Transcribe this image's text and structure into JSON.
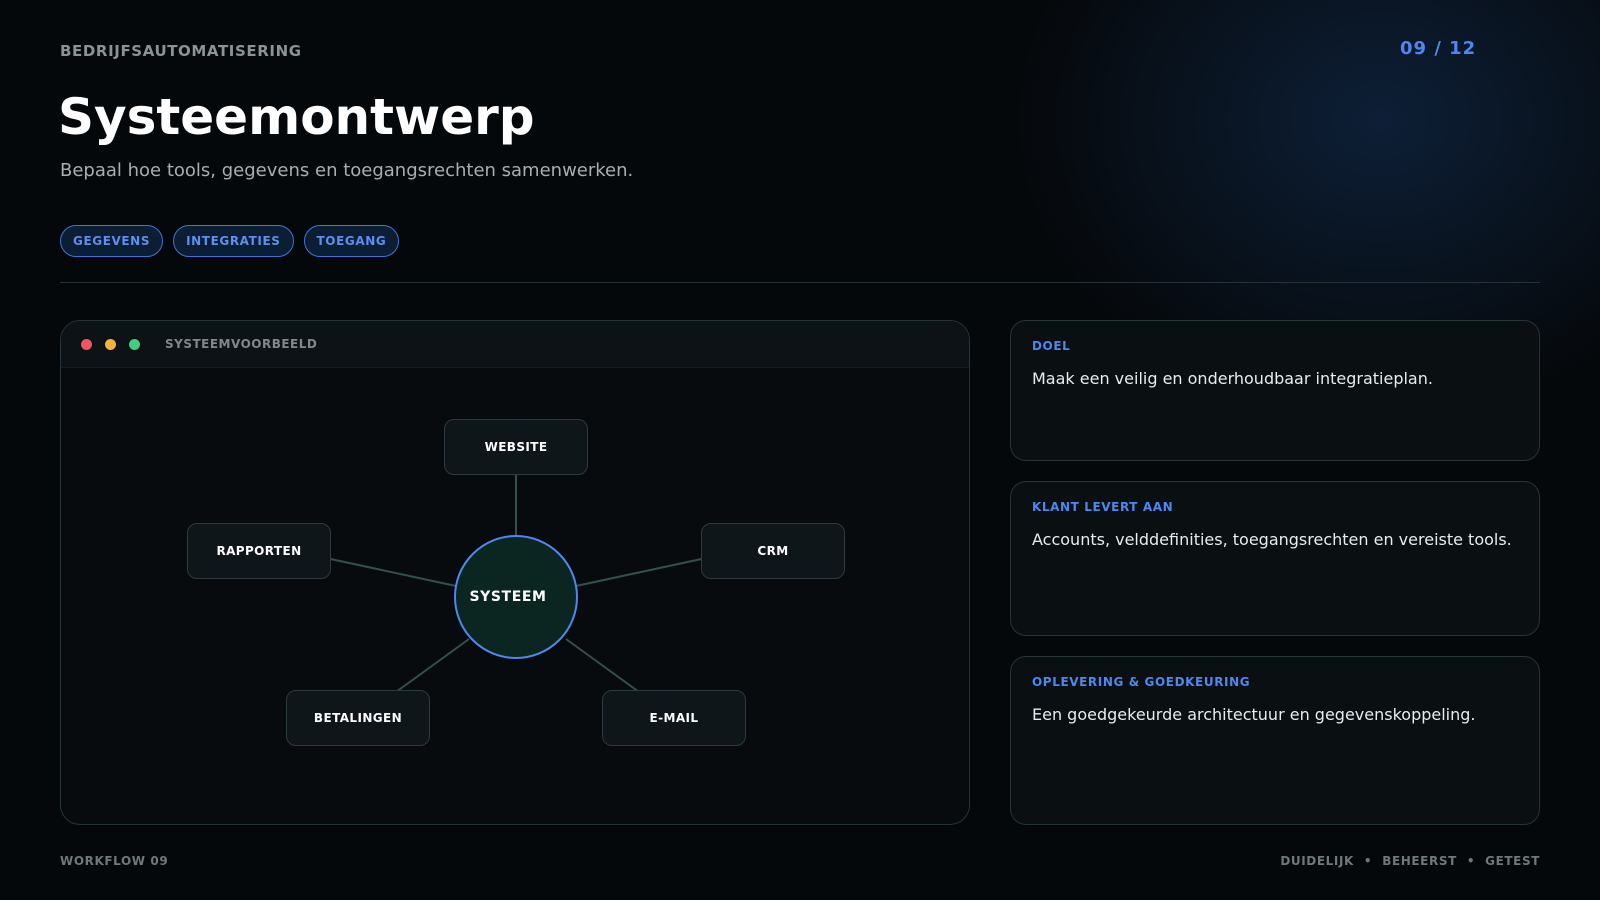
{
  "header": {
    "kicker": "BEDRIJFSAUTOMATISERING",
    "page_number": "09 / 12",
    "title": "Systeemontwerp",
    "subtitle": "Bepaal hoe tools, gegevens en toegangsrechten samenwerken."
  },
  "tags": [
    "GEGEVENS",
    "INTEGRATIES",
    "TOEGANG"
  ],
  "window": {
    "title": "SYSTEEMVOORBEELD",
    "dot_colors": [
      "#f0565a",
      "#f5b13a",
      "#3fcf7f"
    ],
    "hub_label": "SYSTEEM",
    "nodes": {
      "website": "WEBSITE",
      "rapporten": "RAPPORTEN",
      "crm": "CRM",
      "betalingen": "BETALINGEN",
      "email": "E-MAIL"
    }
  },
  "cards": [
    {
      "label": "DOEL",
      "text": "Maak een veilig en onderhoudbaar integratieplan."
    },
    {
      "label": "KLANT LEVERT AAN",
      "text": "Accounts, velddefinities, toegangsrechten en vereiste tools."
    },
    {
      "label": "OPLEVERING & GOEDKEURING",
      "text": "Een goedgekeurde architectuur en gegevenskoppeling."
    }
  ],
  "footer": {
    "left": "WORKFLOW 09",
    "right": [
      "DUIDELIJK",
      "BEHEERST",
      "GETEST"
    ],
    "separator": "•"
  },
  "colors": {
    "accent": "#4f87f0",
    "background": "#05080b",
    "hub_fill": "#0b2520",
    "connector": "#34504c"
  }
}
